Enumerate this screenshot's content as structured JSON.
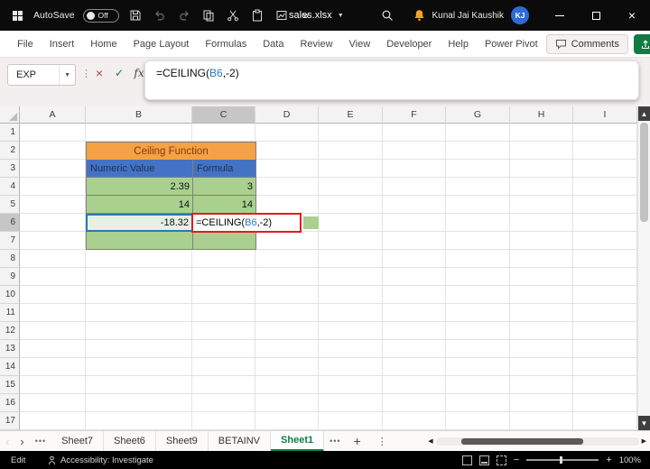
{
  "titlebar": {
    "autosave_label": "AutoSave",
    "autosave_state": "Off",
    "filename": "sales.xlsx",
    "user_name": "Kunal Jai Kaushik",
    "avatar_initials": "KJ"
  },
  "ribbon": {
    "tabs": [
      "File",
      "Insert",
      "Home",
      "Page Layout",
      "Formulas",
      "Data",
      "Review",
      "View",
      "Developer",
      "Help",
      "Power Pivot"
    ],
    "comments_label": "Comments"
  },
  "formula_bar": {
    "name_box": "EXP",
    "formula_prefix": "=CEILING(",
    "formula_ref": "B6",
    "formula_suffix": ",-2)"
  },
  "grid": {
    "columns": [
      "A",
      "B",
      "C",
      "D",
      "E",
      "F",
      "G",
      "H",
      "I"
    ],
    "rows": [
      "1",
      "2",
      "3",
      "4",
      "5",
      "6",
      "7",
      "8",
      "9",
      "10",
      "11",
      "12",
      "13",
      "14",
      "15",
      "16",
      "17"
    ],
    "active_column": "C",
    "active_row": "6"
  },
  "table": {
    "title": "Ceiling Function",
    "headers": [
      "Numeric Value",
      "Formula"
    ],
    "rows": [
      {
        "value": "2.39",
        "result": "3"
      },
      {
        "value": "14",
        "result": "14"
      },
      {
        "value": "-18.32",
        "result_prefix": "=CEILING(",
        "result_ref": "B6",
        "result_suffix": ",-2)"
      },
      {
        "value": "",
        "result": ""
      }
    ]
  },
  "sheet_tabs": {
    "tabs": [
      "Sheet7",
      "Sheet6",
      "Sheet9",
      "BETAINV",
      "Sheet1"
    ],
    "active": "Sheet1"
  },
  "status_bar": {
    "mode": "Edit",
    "accessibility": "Accessibility: Investigate",
    "zoom": "100%"
  },
  "colors": {
    "table-orange": "#F4A243",
    "table-orange-text": "#843C0C",
    "table-blue": "#4472C4",
    "table-blue-text": "#1F3050",
    "table-green": "#A9D08E",
    "reference-blue": "#2E75B6",
    "annotation-red": "#E8191C",
    "excel-green": "#107C41",
    "avatar-blue": "#2D6BD8"
  }
}
